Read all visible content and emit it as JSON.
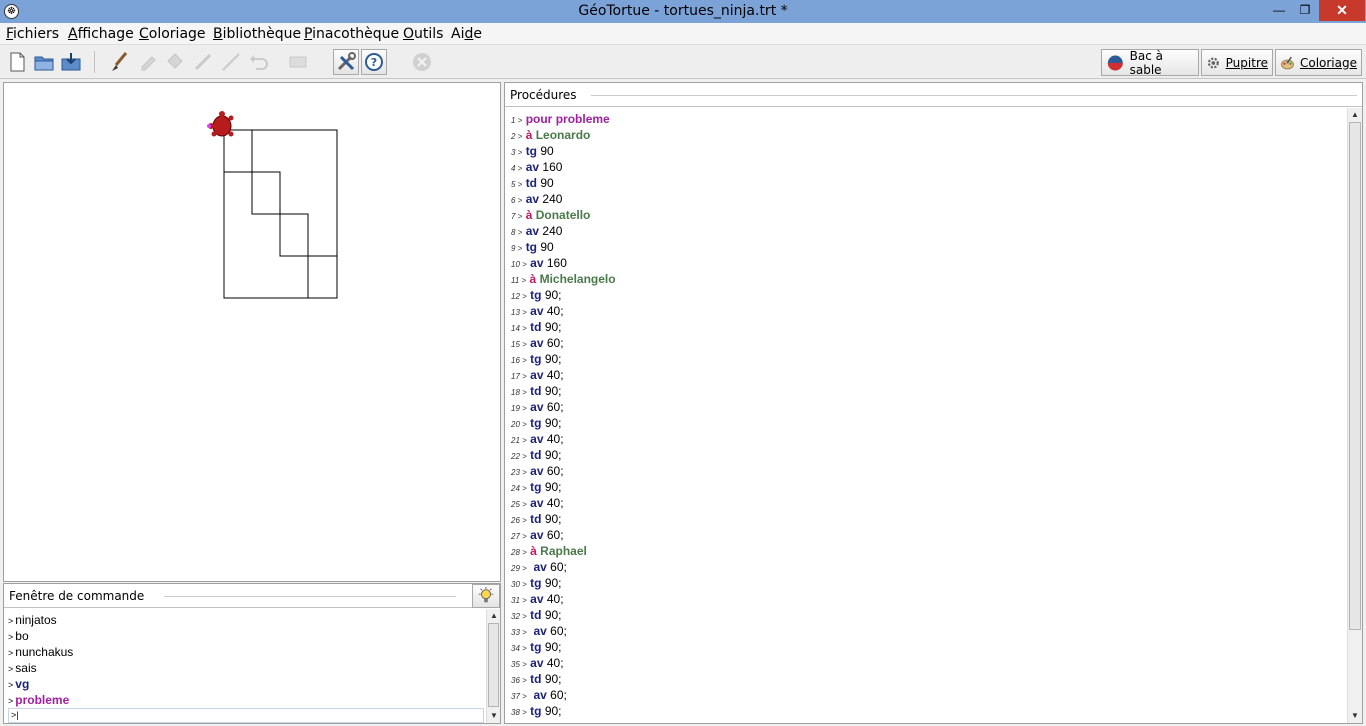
{
  "window": {
    "title": "GéoTortue - tortues_ninja.trt *",
    "minimize": "—",
    "maximize": "❐",
    "close": "✕"
  },
  "menu": {
    "items": [
      {
        "label": "Fichiers",
        "underline": "F",
        "rest": "ichiers"
      },
      {
        "label": "Affichage",
        "underline": "A",
        "rest": "ffichage"
      },
      {
        "label": "Coloriage",
        "underline": "C",
        "rest": "oloriage"
      },
      {
        "label": "Bibliothèque",
        "underline": "B",
        "rest": "ibliothèque"
      },
      {
        "label": "Pinacothèque",
        "underline": "P",
        "rest": "inacothèque"
      },
      {
        "label": "Outils",
        "underline": "O",
        "rest": "utils"
      },
      {
        "label": "Aide",
        "prefix": "Ai",
        "underline": "d",
        "rest": "e"
      }
    ]
  },
  "toolbar": {
    "modes": [
      {
        "label": "Bac à sable",
        "icon": "sandbox-icon"
      },
      {
        "label": "Pupitre",
        "icon": "gear-icon"
      },
      {
        "label": "Coloriage",
        "icon": "palette-icon"
      }
    ]
  },
  "command_window": {
    "title": "Fenêtre de commande",
    "prompt": ">",
    "history": [
      {
        "text": "ninjatos",
        "style": "plain"
      },
      {
        "text": "bo",
        "style": "plain"
      },
      {
        "text": "nunchakus",
        "style": "plain"
      },
      {
        "text": "sais",
        "style": "plain"
      },
      {
        "text": "vg",
        "style": "blue"
      },
      {
        "text": "probleme",
        "style": "purple"
      }
    ],
    "input_value": ""
  },
  "procedures": {
    "title": "Procédures",
    "lines": [
      {
        "n": "1 >",
        "kw": "pour",
        "name": "probleme",
        "type": "pour"
      },
      {
        "n": "2 >",
        "kw": "à",
        "name": "Leonardo",
        "type": "a"
      },
      {
        "n": "3 >",
        "kw": "tg",
        "val": "90",
        "type": "cmd"
      },
      {
        "n": "4 >",
        "kw": "av",
        "val": "160",
        "type": "cmd"
      },
      {
        "n": "5 >",
        "kw": "td",
        "val": "90",
        "type": "cmd"
      },
      {
        "n": "6 >",
        "kw": "av",
        "val": "240",
        "type": "cmd"
      },
      {
        "n": "7 >",
        "kw": "à",
        "name": "Donatello",
        "type": "a"
      },
      {
        "n": "8 >",
        "kw": "av",
        "val": "240",
        "type": "cmd"
      },
      {
        "n": "9 >",
        "kw": "tg",
        "val": "90",
        "type": "cmd"
      },
      {
        "n": "10 >",
        "kw": "av",
        "val": "160",
        "type": "cmd"
      },
      {
        "n": "11 >",
        "kw": "à",
        "name": "Michelangelo",
        "type": "a"
      },
      {
        "n": "12 >",
        "kw": "tg",
        "val": "90;",
        "type": "cmd"
      },
      {
        "n": "13 >",
        "kw": "av",
        "val": "40;",
        "type": "cmd"
      },
      {
        "n": "14 >",
        "kw": "td",
        "val": "90;",
        "type": "cmd"
      },
      {
        "n": "15 >",
        "kw": "av",
        "val": "60;",
        "type": "cmd"
      },
      {
        "n": "16 >",
        "kw": "tg",
        "val": "90;",
        "type": "cmd"
      },
      {
        "n": "17 >",
        "kw": "av",
        "val": "40;",
        "type": "cmd"
      },
      {
        "n": "18 >",
        "kw": "td",
        "val": "90;",
        "type": "cmd"
      },
      {
        "n": "19 >",
        "kw": "av",
        "val": "60;",
        "type": "cmd"
      },
      {
        "n": "20 >",
        "kw": "tg",
        "val": "90;",
        "type": "cmd"
      },
      {
        "n": "21 >",
        "kw": "av",
        "val": "40;",
        "type": "cmd"
      },
      {
        "n": "22 >",
        "kw": "td",
        "val": "90;",
        "type": "cmd"
      },
      {
        "n": "23 >",
        "kw": "av",
        "val": "60;",
        "type": "cmd"
      },
      {
        "n": "24 >",
        "kw": "tg",
        "val": "90;",
        "type": "cmd"
      },
      {
        "n": "25 >",
        "kw": "av",
        "val": "40;",
        "type": "cmd"
      },
      {
        "n": "26 >",
        "kw": "td",
        "val": "90;",
        "type": "cmd"
      },
      {
        "n": "27 >",
        "kw": "av",
        "val": "60;",
        "type": "cmd"
      },
      {
        "n": "28 >",
        "kw": "à",
        "name": "Raphael",
        "type": "a"
      },
      {
        "n": "29 >",
        "kw": " av",
        "val": "60;",
        "type": "cmd"
      },
      {
        "n": "30 >",
        "kw": "tg",
        "val": "90;",
        "type": "cmd"
      },
      {
        "n": "31 >",
        "kw": "av",
        "val": "40;",
        "type": "cmd"
      },
      {
        "n": "32 >",
        "kw": "td",
        "val": "90;",
        "type": "cmd"
      },
      {
        "n": "33 >",
        "kw": " av",
        "val": "60;",
        "type": "cmd"
      },
      {
        "n": "34 >",
        "kw": "tg",
        "val": "90;",
        "type": "cmd"
      },
      {
        "n": "35 >",
        "kw": "av",
        "val": "40;",
        "type": "cmd"
      },
      {
        "n": "36 >",
        "kw": "td",
        "val": "90;",
        "type": "cmd"
      },
      {
        "n": "37 >",
        "kw": " av",
        "val": "60;",
        "type": "cmd"
      },
      {
        "n": "38 >",
        "kw": "tg",
        "val": "90;",
        "type": "cmd"
      }
    ]
  },
  "colors": {
    "pour": "#a020a0",
    "a": "#c2185b",
    "name": "#4a7a4a",
    "cmd": "#1a237e",
    "turtle": "#b71c1c"
  }
}
